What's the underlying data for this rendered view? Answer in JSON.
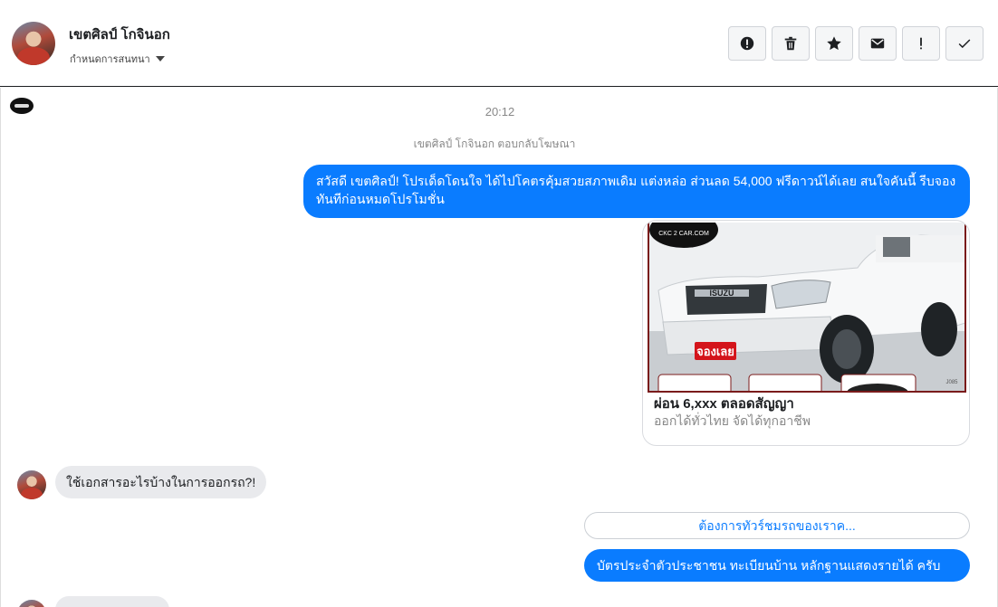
{
  "header": {
    "contact_name": "เขตศิลป์ โกจินอก",
    "assign_label": "กำหนดการสนทนา",
    "toolbar": [
      {
        "icon": "alert-circle-icon",
        "name": "mark-spam-button"
      },
      {
        "icon": "trash-icon",
        "name": "delete-button"
      },
      {
        "icon": "star-icon",
        "name": "star-button"
      },
      {
        "icon": "envelope-icon",
        "name": "mark-unread-button"
      },
      {
        "icon": "exclamation-icon",
        "name": "follow-up-button"
      },
      {
        "icon": "check-icon",
        "name": "mark-done-button"
      }
    ]
  },
  "thread": {
    "timestamp": "20:12",
    "reply_note": "เขตศิลป์ โกจินอก ตอบกลับโฆษณา",
    "message_1": "สวัสดี เขตศิลป์! โปรเด็ดโดนใจ ได้ไปโคตรคุ้มสวยสภาพเดิม แต่งหล่อ  ส่วนลด 54,000 ฟรีดาวน์ได้เลย  สนใจคันนี้ รีบจองทันทีก่อนหมดโปรโมชั่น",
    "card": {
      "title": "ผ่อน 6,xxx ตลอดสัญญา",
      "subtitle": "ออกได้ทั่วไทย จัดได้ทุกอาชีพ",
      "image_brand": "ISUZU",
      "image_badge": "จองเลย",
      "image_logo": "CKC 2 CAR.COM",
      "image_plate": "J085"
    },
    "message_2": "ใช้เอกสารอะไรบ้างในการออกรถ?!",
    "quick_reply": "ต้องการทัวร์ชมรถของเราค...",
    "message_3": "บัตรประจำตัวประชาชน ทะเบียนบ้าน หลักฐานแสดงรายได้ ครับ"
  },
  "colors": {
    "brand_blue": "#0a7cff",
    "incoming_bubble": "#e9eaed",
    "muted_text": "#888888"
  }
}
